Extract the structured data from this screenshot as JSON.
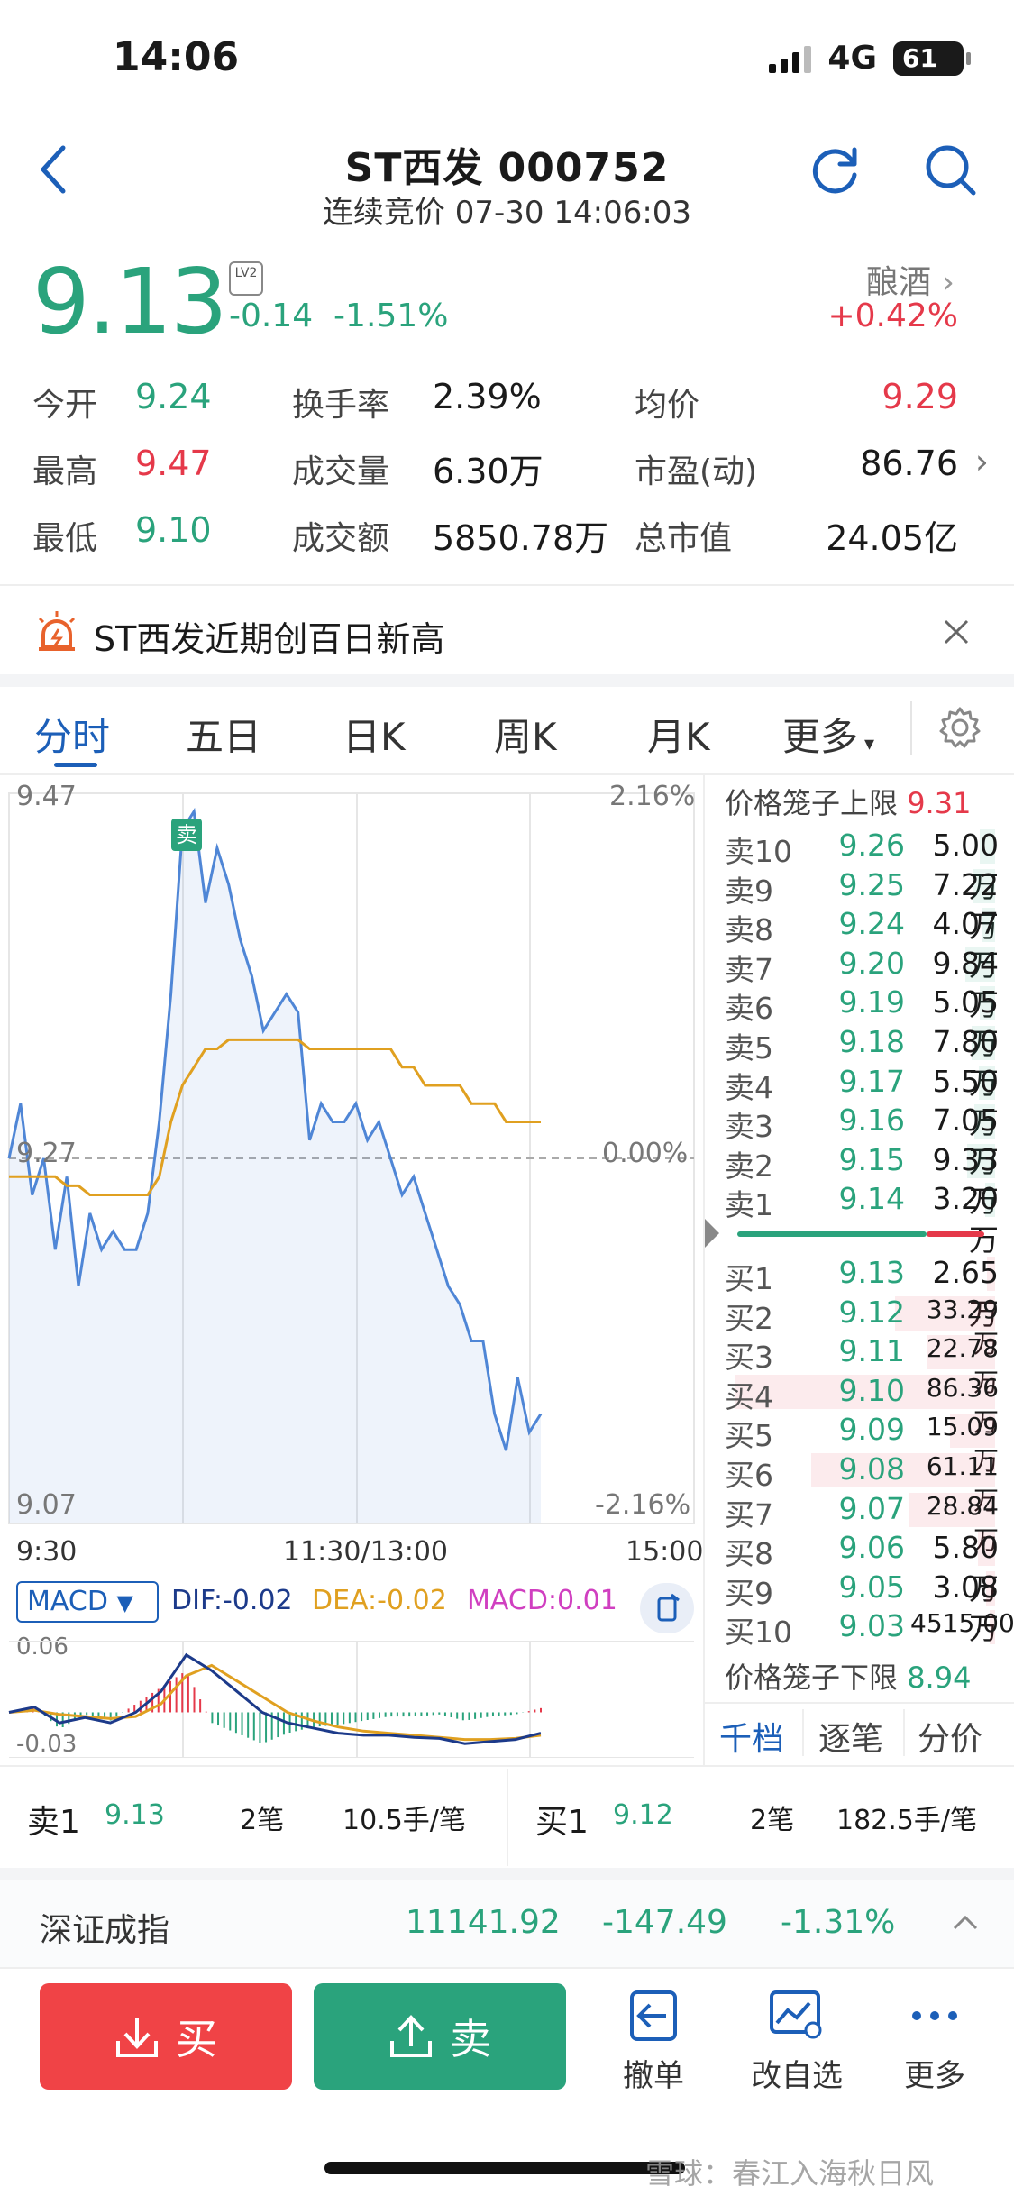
{
  "status": {
    "time": "14:06",
    "network": "4G",
    "battery": "61"
  },
  "header": {
    "title": "ST西发 000752",
    "subtitle": "连续竞价 07-30 14:06:03"
  },
  "quote": {
    "price": "9.13",
    "level_badge": "LV2",
    "change": "-0.14",
    "change_pct": "-1.51%",
    "sector": "酿酒",
    "sector_chg": "+0.42%",
    "stats": [
      {
        "label": "今开",
        "value": "9.24"
      },
      {
        "label": "换手率",
        "value": "2.39%"
      },
      {
        "label": "均价",
        "value": "9.29"
      },
      {
        "label": "最高",
        "value": "9.47"
      },
      {
        "label": "成交量",
        "value": "6.30万"
      },
      {
        "label": "市盈(动)",
        "value": "86.76"
      },
      {
        "label": "最低",
        "value": "9.10"
      },
      {
        "label": "成交额",
        "value": "5850.78万"
      },
      {
        "label": "总市值",
        "value": "24.05亿"
      }
    ]
  },
  "alert": {
    "text": "ST西发近期创百日新高"
  },
  "tabs": [
    "分时",
    "五日",
    "日K",
    "周K",
    "月K",
    "更多"
  ],
  "chart": {
    "y_top": "9.47",
    "y_mid": "9.27",
    "y_bot": "9.07",
    "pct_top": "2.16%",
    "pct_mid": "0.00%",
    "pct_bot": "-2.16%",
    "x_left": "9:30",
    "x_mid": "11:30/13:00",
    "x_right": "15:00",
    "sell_marker": "卖"
  },
  "chart_data": [
    {
      "type": "line",
      "title": "",
      "x": [
        "9:30",
        "11:30/13:00",
        "15:00"
      ],
      "ylim": [
        9.07,
        9.47
      ],
      "series": [
        {
          "name": "price",
          "values": [
            9.27,
            9.3,
            9.25,
            9.27,
            9.22,
            9.26,
            9.2,
            9.24,
            9.22,
            9.23,
            9.22,
            9.22,
            9.24,
            9.29,
            9.36,
            9.45,
            9.46,
            9.41,
            9.44,
            9.42,
            9.39,
            9.37,
            9.34,
            9.35,
            9.36,
            9.35,
            9.28,
            9.3,
            9.29,
            9.29,
            9.3,
            9.28,
            9.29,
            9.27,
            9.25,
            9.26,
            9.24,
            9.22,
            9.2,
            9.19,
            9.17,
            9.17,
            9.13,
            9.11,
            9.15,
            9.12,
            9.13
          ]
        },
        {
          "name": "avg",
          "values": [
            9.26,
            9.26,
            9.26,
            9.26,
            9.26,
            9.255,
            9.255,
            9.25,
            9.25,
            9.25,
            9.25,
            9.25,
            9.25,
            9.26,
            9.29,
            9.31,
            9.32,
            9.33,
            9.33,
            9.335,
            9.335,
            9.335,
            9.335,
            9.335,
            9.335,
            9.335,
            9.33,
            9.33,
            9.33,
            9.33,
            9.33,
            9.33,
            9.33,
            9.33,
            9.32,
            9.32,
            9.31,
            9.31,
            9.31,
            9.31,
            9.3,
            9.3,
            9.3,
            9.29,
            9.29,
            9.29,
            9.29
          ]
        }
      ]
    },
    {
      "type": "line",
      "title": "",
      "ylim": [
        -0.03,
        0.06
      ],
      "series": [
        {
          "name": "DIF",
          "values": [
            0.0,
            0.005,
            -0.01,
            -0.005,
            -0.01,
            0.0,
            0.02,
            0.055,
            0.04,
            0.02,
            0.0,
            -0.01,
            -0.015,
            -0.02,
            -0.022,
            -0.022,
            -0.024,
            -0.025,
            -0.03,
            -0.028,
            -0.026,
            -0.02
          ]
        },
        {
          "name": "DEA",
          "values": [
            0.0,
            0.002,
            -0.002,
            -0.004,
            -0.006,
            -0.004,
            0.008,
            0.035,
            0.045,
            0.03,
            0.015,
            0.0,
            -0.008,
            -0.014,
            -0.018,
            -0.02,
            -0.022,
            -0.024,
            -0.026,
            -0.026,
            -0.025,
            -0.022
          ]
        }
      ]
    }
  ],
  "macd": {
    "name": "MACD",
    "dif": "DIF:-0.02",
    "dea": "DEA:-0.02",
    "macd": "MACD:0.01",
    "top": "0.06",
    "bot": "-0.03"
  },
  "orderbook": {
    "upper_limit_label": "价格笼子上限",
    "upper_limit": "9.31",
    "lower_limit_label": "价格笼子下限",
    "lower_limit": "8.94",
    "sells": [
      {
        "label": "卖10",
        "price": "9.26",
        "vol": "5.00万"
      },
      {
        "label": "卖9",
        "price": "9.25",
        "vol": "7.22万"
      },
      {
        "label": "卖8",
        "price": "9.24",
        "vol": "4.07万"
      },
      {
        "label": "卖7",
        "price": "9.20",
        "vol": "9.84万"
      },
      {
        "label": "卖6",
        "price": "9.19",
        "vol": "5.05万"
      },
      {
        "label": "卖5",
        "price": "9.18",
        "vol": "7.80万"
      },
      {
        "label": "卖4",
        "price": "9.17",
        "vol": "5.50万"
      },
      {
        "label": "卖3",
        "price": "9.16",
        "vol": "7.05万"
      },
      {
        "label": "卖2",
        "price": "9.15",
        "vol": "9.33万"
      },
      {
        "label": "卖1",
        "price": "9.14",
        "vol": "3.20万"
      }
    ],
    "buys": [
      {
        "label": "买1",
        "price": "9.13",
        "vol": "2.65万"
      },
      {
        "label": "买2",
        "price": "9.12",
        "vol": "33.29万"
      },
      {
        "label": "买3",
        "price": "9.11",
        "vol": "22.78万"
      },
      {
        "label": "买4",
        "price": "9.10",
        "vol": "86.36万"
      },
      {
        "label": "买5",
        "price": "9.09",
        "vol": "15.09万"
      },
      {
        "label": "买6",
        "price": "9.08",
        "vol": "61.11万"
      },
      {
        "label": "买7",
        "price": "9.07",
        "vol": "28.84万"
      },
      {
        "label": "买8",
        "price": "9.06",
        "vol": "5.80万"
      },
      {
        "label": "买9",
        "price": "9.05",
        "vol": "3.08万"
      },
      {
        "label": "买10",
        "price": "9.03",
        "vol": "4515.00"
      }
    ],
    "tabs": [
      "千档",
      "逐笔",
      "分价"
    ]
  },
  "summary": {
    "sell": {
      "label": "卖1",
      "price": "9.13",
      "count": "2笔",
      "avg": "10.5手/笔"
    },
    "buy": {
      "label": "买1",
      "price": "9.12",
      "count": "2笔",
      "avg": "182.5手/笔"
    }
  },
  "index": {
    "name": "深证成指",
    "value": "11141.92",
    "change": "-147.49",
    "pct": "-1.31%"
  },
  "actions": {
    "buy": "买",
    "sell": "卖",
    "cancel": "撤单",
    "edit": "改自选",
    "more": "更多"
  },
  "watermark": "雪球：春江入海秋日风",
  "colors": {
    "green": "#2aa37c",
    "red": "#e5394a",
    "blue": "#1c5fb8",
    "avg_line": "#e0a020"
  }
}
